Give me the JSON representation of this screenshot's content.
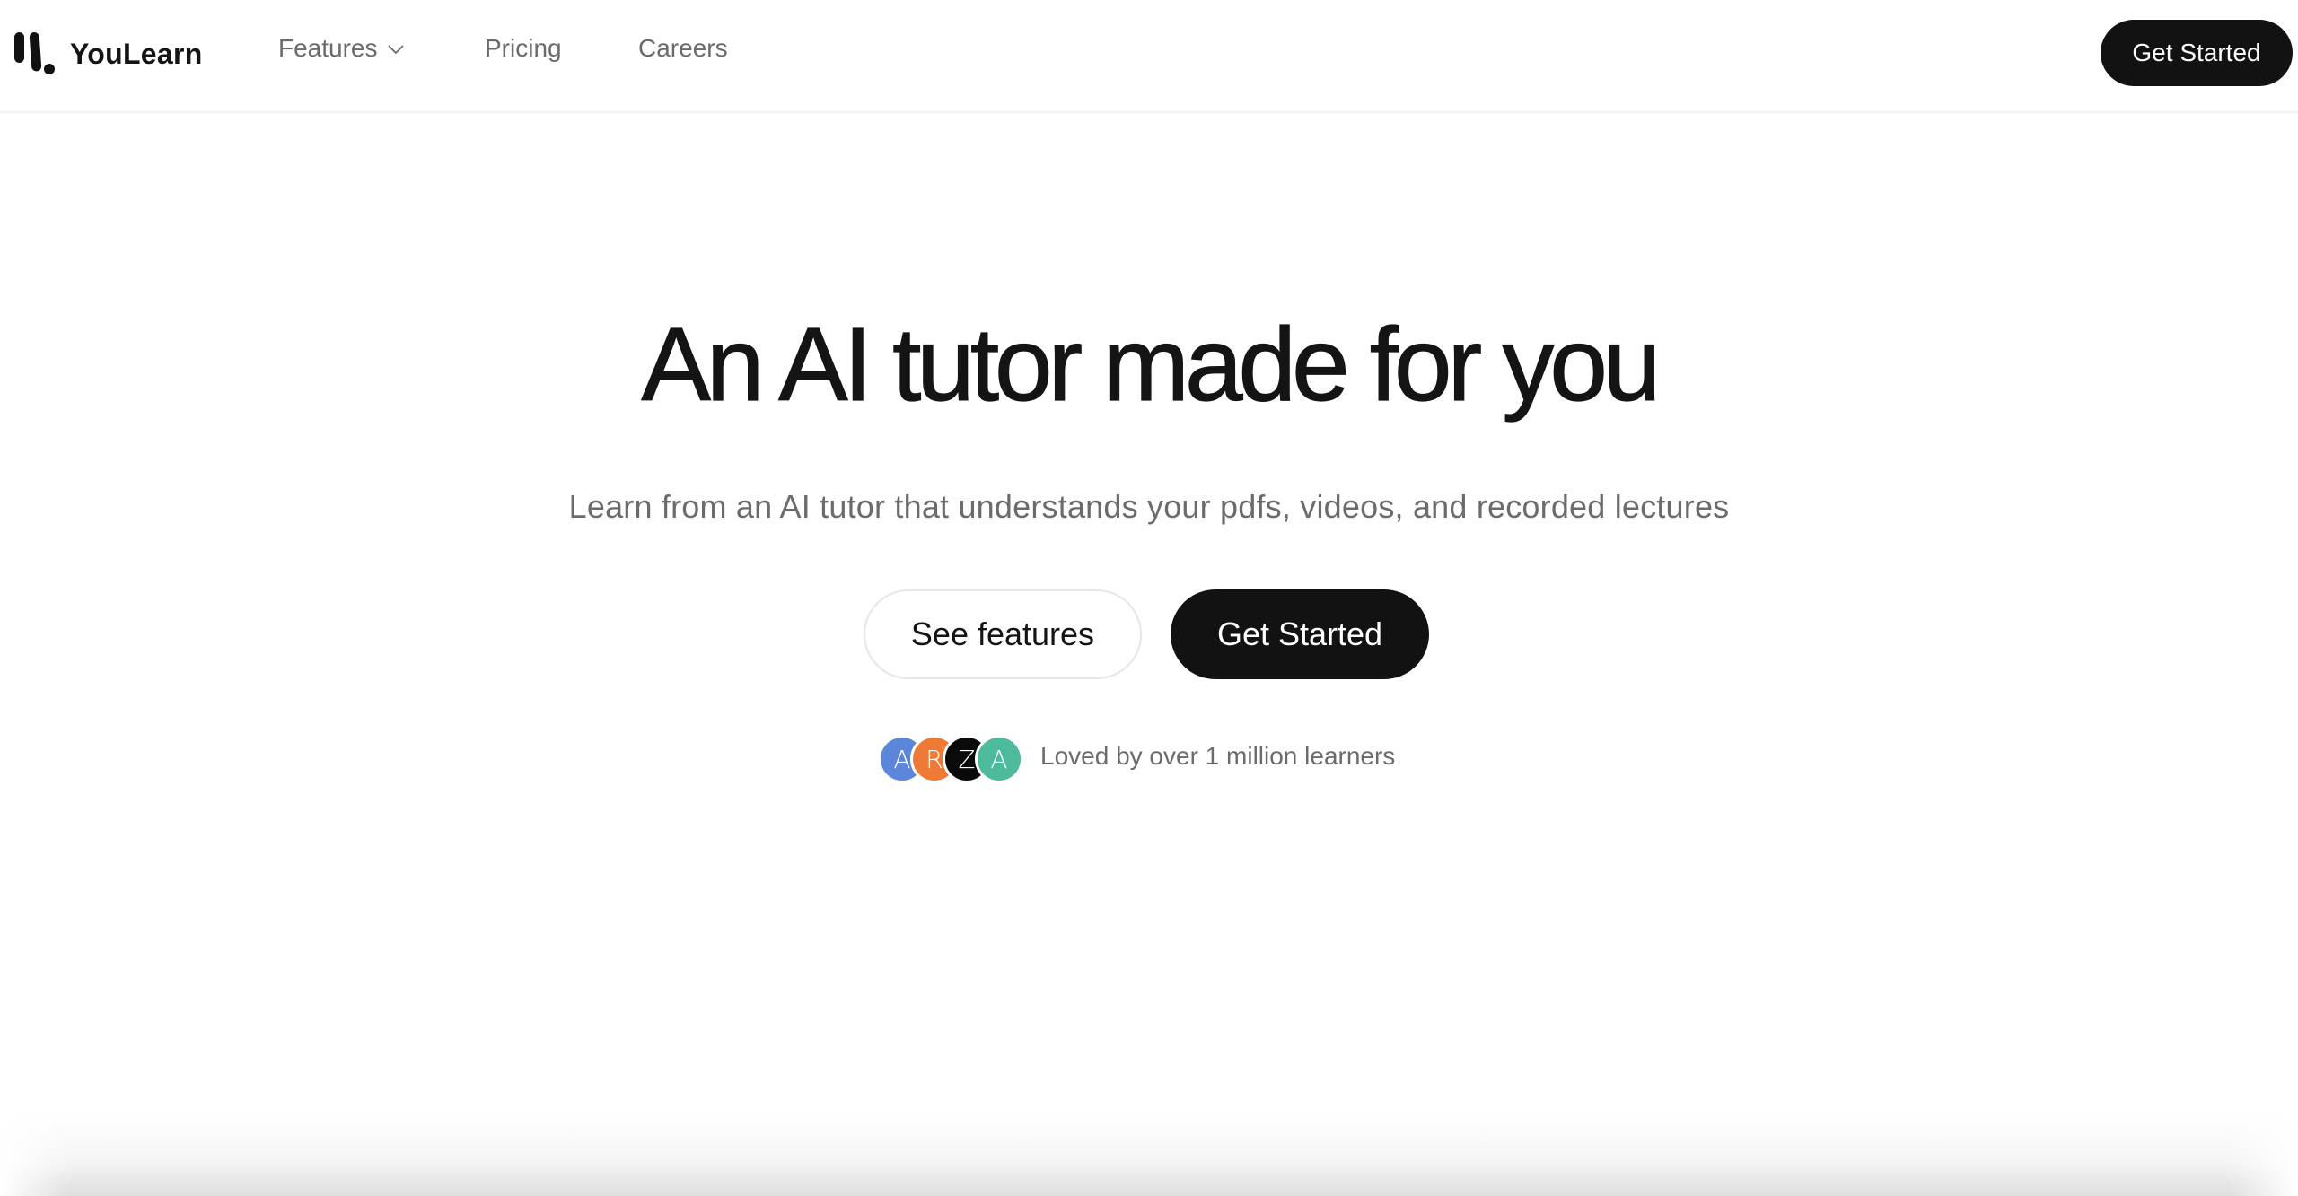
{
  "header": {
    "brand": "YouLearn",
    "nav": [
      {
        "label": "Features",
        "has_dropdown": true
      },
      {
        "label": "Pricing"
      },
      {
        "label": "Careers"
      }
    ],
    "cta_label": "Get Started"
  },
  "hero": {
    "title": "An AI tutor made for you",
    "subtitle": "Learn from an AI tutor that understands your pdfs, videos, and recorded lectures",
    "secondary_cta": "See features",
    "primary_cta": "Get Started"
  },
  "social_proof": {
    "avatars": [
      {
        "initial": "A",
        "color": "#5b86d9"
      },
      {
        "initial": "R",
        "color": "#ee7a35"
      },
      {
        "initial": "Z",
        "color": "#0a0a0a"
      },
      {
        "initial": "A",
        "color": "#4dba9c"
      }
    ],
    "text": "Loved by over 1 million learners"
  },
  "icons": {
    "logo": "youlearn-logo-icon",
    "dropdown": "chevron-down-icon"
  }
}
